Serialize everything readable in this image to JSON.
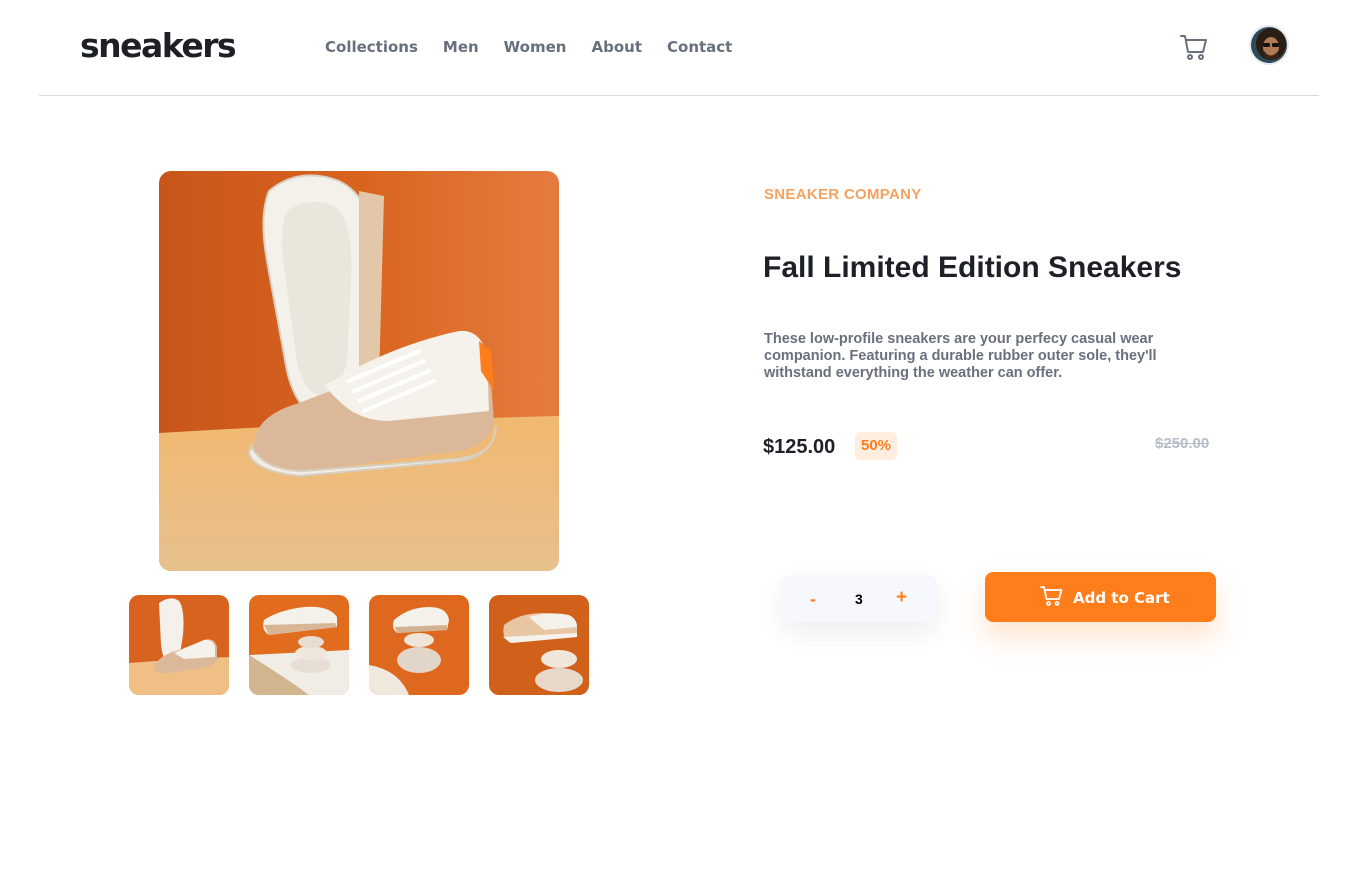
{
  "header": {
    "logo": "sneakers",
    "nav": [
      "Collections",
      "Men",
      "Women",
      "About",
      "Contact"
    ],
    "cart_icon": "cart-icon",
    "avatar_icon": "user-avatar"
  },
  "product": {
    "company": "SNEAKER COMPANY",
    "title": "Fall Limited Edition Sneakers",
    "description": "These low-profile sneakers are your perfecy casual wear companion. Featuring a durable rubber outer sole, they'll withstand everything the weather can offer.",
    "price": "$125.00",
    "discount": "50%",
    "old_price": "$250.00"
  },
  "quantity": {
    "minus": "-",
    "value": "3",
    "plus": "+"
  },
  "add_to_cart": {
    "label": "Add to Cart",
    "icon": "cart-icon"
  },
  "gallery": {
    "thumbnails": 4
  },
  "colors": {
    "accent": "#ff7e1b",
    "accent_light": "#ffede0",
    "text_dark": "#1d2026",
    "text_muted": "#69707d",
    "strike": "#b6bcc8"
  }
}
